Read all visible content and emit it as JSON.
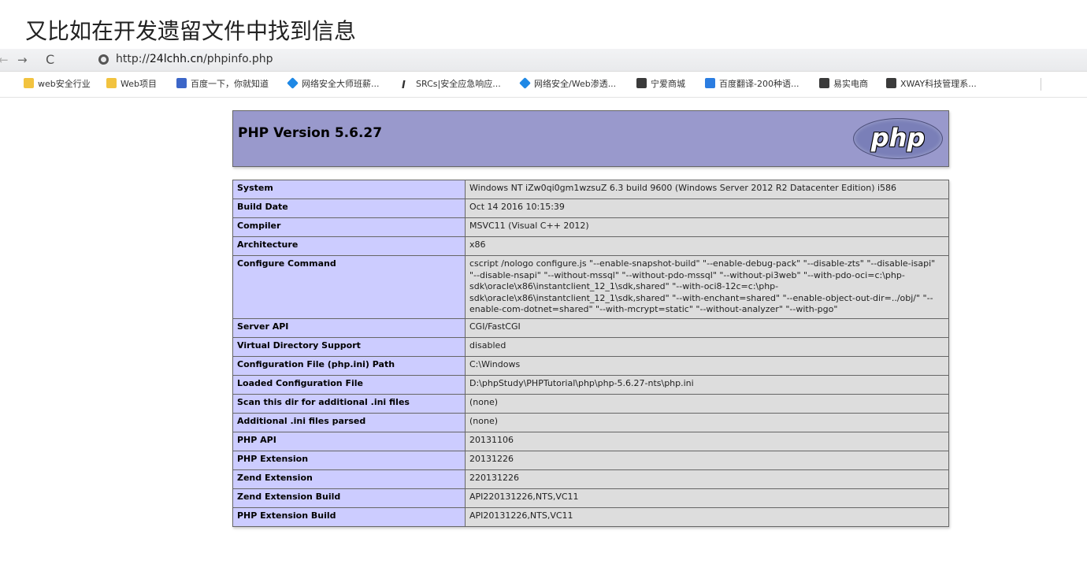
{
  "caption": "又比如在开发遗留文件中找到信息",
  "browser": {
    "nav": {
      "back": "←",
      "forward": "→",
      "reload": "C"
    },
    "url_prefix": "http://",
    "url_host": "24lchh.cn",
    "url_path": "/phpinfo.php",
    "bookmarks": [
      {
        "label": "web安全行业",
        "icon": "folder-icon"
      },
      {
        "label": "Web项目",
        "icon": "folder-icon"
      },
      {
        "label": "百度一下，你就知道",
        "icon": "baidu-paw-icon"
      },
      {
        "label": "网络安全大师班薪...",
        "icon": "diamond-icon"
      },
      {
        "label": "SRCs|安全应急响应...",
        "icon": "italic-i-icon"
      },
      {
        "label": "网络安全/Web渗透...",
        "icon": "diamond-icon"
      },
      {
        "label": "宁爱商城",
        "icon": "globe-icon"
      },
      {
        "label": "百度翻译-200种语...",
        "icon": "translate-icon"
      },
      {
        "label": "易实电商",
        "icon": "globe-icon"
      },
      {
        "label": "XWAY科技管理系...",
        "icon": "globe-icon"
      }
    ]
  },
  "phpinfo": {
    "title": "PHP Version 5.6.27",
    "logo_text": "php",
    "rows": [
      {
        "key": "System",
        "value": "Windows NT iZw0qi0gm1wzsuZ 6.3 build 9600 (Windows Server 2012 R2 Datacenter Edition) i586"
      },
      {
        "key": "Build Date",
        "value": "Oct 14 2016 10:15:39"
      },
      {
        "key": "Compiler",
        "value": "MSVC11 (Visual C++ 2012)"
      },
      {
        "key": "Architecture",
        "value": "x86"
      },
      {
        "key": "Configure Command",
        "value": "cscript /nologo configure.js \"--enable-snapshot-build\" \"--enable-debug-pack\" \"--disable-zts\" \"--disable-isapi\" \"--disable-nsapi\" \"--without-mssql\" \"--without-pdo-mssql\" \"--without-pi3web\" \"--with-pdo-oci=c:\\php-sdk\\oracle\\x86\\instantclient_12_1\\sdk,shared\" \"--with-oci8-12c=c:\\php-sdk\\oracle\\x86\\instantclient_12_1\\sdk,shared\" \"--with-enchant=shared\" \"--enable-object-out-dir=../obj/\" \"--enable-com-dotnet=shared\" \"--with-mcrypt=static\" \"--without-analyzer\" \"--with-pgo\""
      },
      {
        "key": "Server API",
        "value": "CGI/FastCGI"
      },
      {
        "key": "Virtual Directory Support",
        "value": "disabled"
      },
      {
        "key": "Configuration File (php.ini) Path",
        "value": "C:\\Windows"
      },
      {
        "key": "Loaded Configuration File",
        "value": "D:\\phpStudy\\PHPTutorial\\php\\php-5.6.27-nts\\php.ini"
      },
      {
        "key": "Scan this dir for additional .ini files",
        "value": "(none)"
      },
      {
        "key": "Additional .ini files parsed",
        "value": "(none)"
      },
      {
        "key": "PHP API",
        "value": "20131106"
      },
      {
        "key": "PHP Extension",
        "value": "20131226"
      },
      {
        "key": "Zend Extension",
        "value": "220131226"
      },
      {
        "key": "Zend Extension Build",
        "value": "API220131226,NTS,VC11"
      },
      {
        "key": "PHP Extension Build",
        "value": "API20131226,NTS,VC11"
      }
    ]
  }
}
